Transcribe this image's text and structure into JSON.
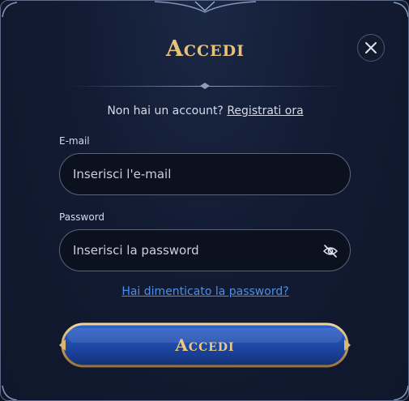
{
  "dialog": {
    "title": "Accedi",
    "signup_prompt": "Non hai un account?",
    "signup_link": "Registrati ora",
    "email": {
      "label": "E-mail",
      "placeholder": "Inserisci l'e-mail",
      "value": ""
    },
    "password": {
      "label": "Password",
      "placeholder": "Inserisci la password",
      "value": "",
      "toggle_icon": "eye-off-icon"
    },
    "forgot_link": "Hai dimenticato la password?",
    "submit_label": "Accedi",
    "close_icon": "close-icon"
  },
  "colors": {
    "background": "#121b32",
    "title_gold": "#e6c27a",
    "link_blue": "#4b8fe8",
    "button_blue": "#1f4aa8",
    "button_border_gold": "#c9a25a"
  }
}
